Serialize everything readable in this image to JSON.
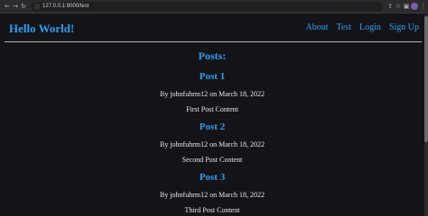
{
  "browser": {
    "url": "127.0.0.1:8000/test",
    "back_icon": "arrow-left-icon",
    "forward_icon": "arrow-right-icon",
    "reload_icon": "reload-icon"
  },
  "site": {
    "title": "Hello World!",
    "nav": [
      "About",
      "Test",
      "Login",
      "Sign Up"
    ]
  },
  "main": {
    "heading": "Posts:",
    "posts": [
      {
        "title": "Post 1",
        "meta": "By johnfuhrm12 on March 18, 2022",
        "content": "First Post Content"
      },
      {
        "title": "Post 2",
        "meta": "By johnfuhrm12 on March 18, 2022",
        "content": "Second Post Content"
      },
      {
        "title": "Post 3",
        "meta": "By johnfuhrm12 on March 18, 2022",
        "content": "Third Post Content"
      }
    ]
  },
  "colors": {
    "accent": "#2f9df0",
    "background": "#141418",
    "text": "#e8e8e8"
  }
}
